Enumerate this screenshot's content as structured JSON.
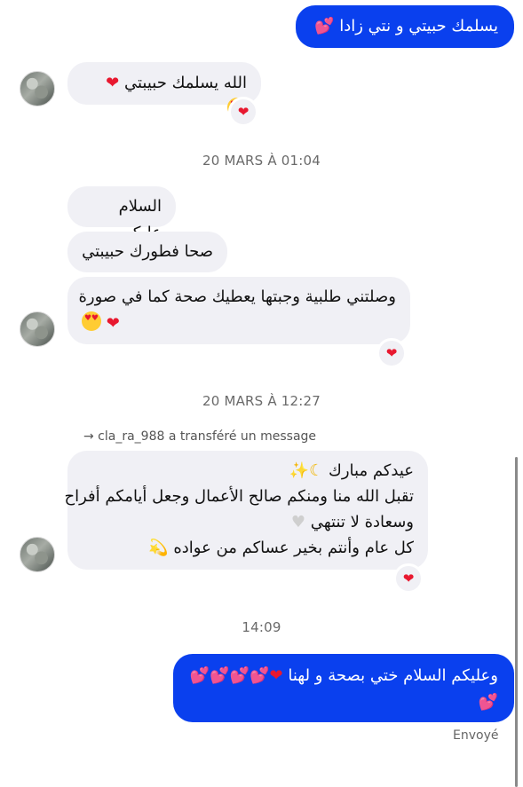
{
  "messages": {
    "out_1": {
      "text": "يسلمك حبيتي و نتي زادا"
    },
    "in_1": {
      "text": "الله يسلمك حبيبتي"
    },
    "stamp_1": "20 MARS À 01:04",
    "in_2": {
      "text": "السلام عليكم"
    },
    "in_3": {
      "text": "صحا فطورك حبيبتي"
    },
    "in_4": {
      "text": "وصلتني طلبية وجبتها يعطيك صحة كما في صورة"
    },
    "stamp_2": "20 MARS À 12:27",
    "forward_note": "→ cla_ra_988 a transféré un message",
    "in_5": {
      "line1": "عيدكم مبارك",
      "line2": "تقبل الله منا ومنكم صالح الأعمال وجعل أيامكم أفراح",
      "line3": "وسعادة لا تنتهي",
      "line4": "كل عام وأنتم بخير عساكم من عواده"
    },
    "stamp_3": "14:09",
    "out_2": {
      "text": "وعليكم السلام ختي بصحة و لهنا"
    },
    "status": "Envoyé"
  },
  "icons": {
    "reaction": "red-heart-icon",
    "pink_heart": "two-hearts-icon",
    "face": "heart-eyes-face-icon",
    "crescent": "crescent-moon-icon",
    "sparkles": "sparkles-icon",
    "white_heart": "white-heart-icon",
    "dizzy": "dizzy-icon"
  },
  "colors": {
    "outgoing_bubble": "#0a40ee",
    "incoming_bubble": "#f0f0f5",
    "reaction_heart": "#e8182f"
  }
}
